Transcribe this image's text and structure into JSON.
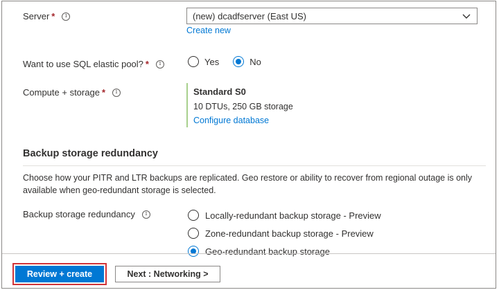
{
  "server": {
    "label": "Server",
    "required_mark": "*",
    "info_icon": "ⓘ",
    "selected": "(new) dcadfserver (East US)",
    "create_new_link": "Create new"
  },
  "elastic_pool": {
    "label": "Want to use SQL elastic pool?",
    "required_mark": "*",
    "info_icon": "ⓘ",
    "options": [
      {
        "label": "Yes",
        "checked": false
      },
      {
        "label": "No",
        "checked": true
      }
    ]
  },
  "compute": {
    "label": "Compute + storage",
    "required_mark": "*",
    "info_icon": "ⓘ",
    "tier": "Standard S0",
    "detail": "10 DTUs, 250 GB storage",
    "configure_link": "Configure database"
  },
  "backup": {
    "heading": "Backup storage redundancy",
    "description": "Choose how your PITR and LTR backups are replicated. Geo restore or ability to recover from regional outage is only available when geo-redundant storage is selected.",
    "label": "Backup storage redundancy",
    "info_icon": "ⓘ",
    "options": [
      {
        "label": "Locally-redundant backup storage - Preview",
        "checked": false
      },
      {
        "label": "Zone-redundant backup storage - Preview",
        "checked": false
      },
      {
        "label": "Geo-redundant backup storage",
        "checked": true
      }
    ]
  },
  "footer": {
    "review_create": "Review + create",
    "next_networking": "Next : Networking >"
  },
  "colors": {
    "accent": "#0078d4",
    "required": "#a4262c",
    "highlight_border": "#d13438",
    "compute_bar": "#a8d08d"
  }
}
